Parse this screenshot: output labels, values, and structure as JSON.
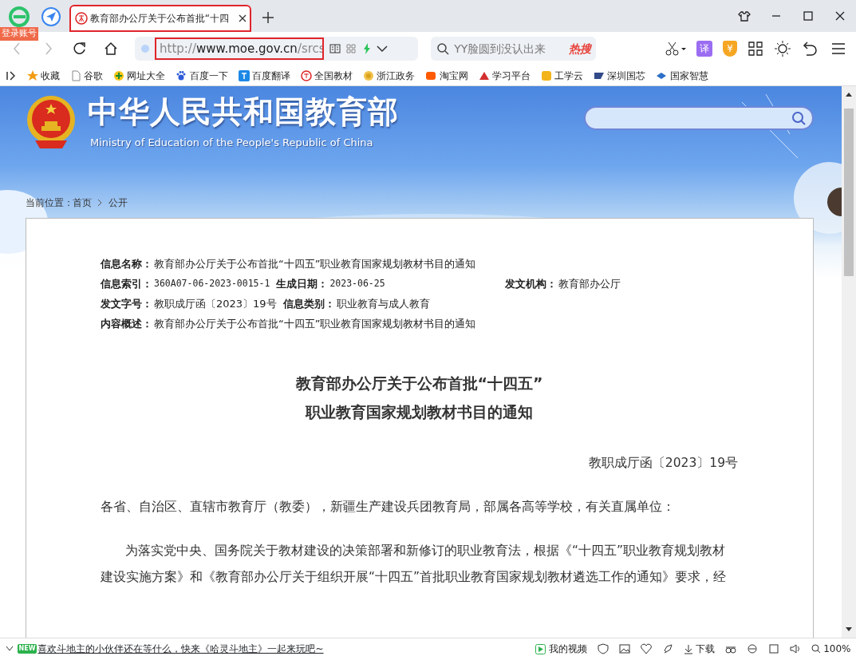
{
  "browser": {
    "account_badge": "登录账号",
    "tabs": [
      {
        "title": "教育部办公厅关于公布首批“十四",
        "selected": true,
        "highlighted": true
      }
    ],
    "address": {
      "scheme": "http://",
      "host": "www.moe.gov.cn",
      "path": "/srcs",
      "highlighted": true
    },
    "search": {
      "placeholder": "YY脸圆到没认出来",
      "hot_label": "热搜"
    },
    "translate_label": "译",
    "coupon_label": "¥",
    "bookmarks": [
      {
        "label": "收藏",
        "kind": "star"
      },
      {
        "label": "谷歌",
        "kind": "page"
      },
      {
        "label": "网址大全",
        "kind": "plus"
      },
      {
        "label": "百度一下",
        "kind": "paw"
      },
      {
        "label": "百度翻译",
        "kind": "translate"
      },
      {
        "label": "全国教材",
        "kind": "emblem"
      },
      {
        "label": "浙江政务",
        "kind": "coin"
      },
      {
        "label": "淘宝网",
        "kind": "tao"
      },
      {
        "label": "学习平台",
        "kind": "study"
      },
      {
        "label": "工学云",
        "kind": "cloud"
      },
      {
        "label": "深圳国芯",
        "kind": "sz"
      },
      {
        "label": "国家智慧",
        "kind": "book"
      }
    ]
  },
  "site": {
    "title": "中华人民共和国教育部",
    "subtitle": "Ministry of Education of the People's Republic of China",
    "breadcrumb": [
      "当前位置：",
      "首页",
      "公开"
    ]
  },
  "meta": [
    [
      {
        "label": "信息名称：",
        "value": "教育部办公厅关于公布首批“十四五”职业教育国家规划教材书目的通知"
      }
    ],
    [
      {
        "label": "信息索引：",
        "value": "360A07-06-2023-0015-1"
      },
      {
        "label": "生成日期：",
        "value": "2023-06-25"
      },
      {
        "label": "发文机构：",
        "value": "教育部办公厅"
      }
    ],
    [
      {
        "label": "发文字号：",
        "value": "教职成厅函〔2023〕19号"
      },
      {
        "label": "信息类别：",
        "value": "职业教育与成人教育"
      }
    ],
    [
      {
        "label": "内容概述：",
        "value": "教育部办公厅关于公布首批“十四五”职业教育国家规划教材书目的通知"
      }
    ]
  ],
  "document": {
    "title_lines": [
      "教育部办公厅关于公布首批“十四五”",
      "职业教育国家规划教材书目的通知"
    ],
    "doc_number": "教职成厅函〔2023〕19号",
    "salutation": "各省、自治区、直辖市教育厅（教委），新疆生产建设兵团教育局，部属各高等学校，有关直属单位：",
    "paragraphs": [
      "为落实党中央、国务院关于教材建设的决策部署和新修订的职业教育法，根据《“十四五”职业教育规划教材建设实施方案》和《教育部办公厅关于组织开展“十四五”首批职业教育国家规划教材遴选工作的通知》要求，经"
    ]
  },
  "status_bar": {
    "news_badge": "NEW",
    "news": "喜欢斗地主的小伙伴还在等什么，快来《哈灵斗地主》一起来玩吧~",
    "video": "我的视频",
    "download": "下载",
    "zoom": "100%"
  }
}
